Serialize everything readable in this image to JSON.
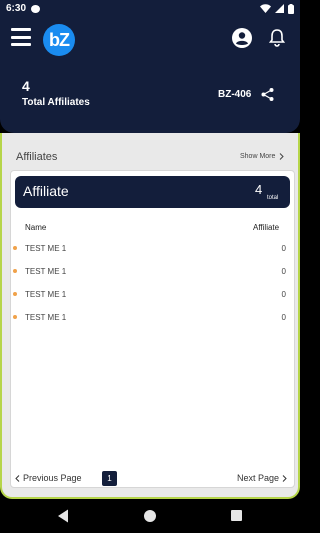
{
  "status_bar": {
    "time": "6:30",
    "icons": [
      "notification-icon",
      "wifi-icon",
      "signal-icon",
      "battery-icon"
    ]
  },
  "app_bar": {
    "logo_text": "bZ",
    "total_count": "4",
    "total_label": "Total Affiliates",
    "code": "BZ-406",
    "icons": [
      "menu-icon",
      "profile-icon",
      "bell-icon",
      "share-icon"
    ]
  },
  "section": {
    "title": "Affiliates",
    "show_more": "Show More"
  },
  "card": {
    "title": "Affiliate",
    "total_value": "4",
    "total_label": "total",
    "columns": [
      "Name",
      "Affiliate"
    ],
    "rows": [
      {
        "name": "TEST ME 1",
        "value": "0"
      },
      {
        "name": "TEST ME 1",
        "value": "0"
      },
      {
        "name": "TEST ME 1",
        "value": "0"
      },
      {
        "name": "TEST ME 1",
        "value": "0"
      }
    ]
  },
  "pager": {
    "prev_label": "Previous Page",
    "current_page": "1",
    "next_label": "Next Page"
  },
  "colors": {
    "header_bg": "#131e3b",
    "logo_bg": "#1a8cf0",
    "row_dot": "#f0a24a",
    "accent_border": "#b6d54a"
  }
}
